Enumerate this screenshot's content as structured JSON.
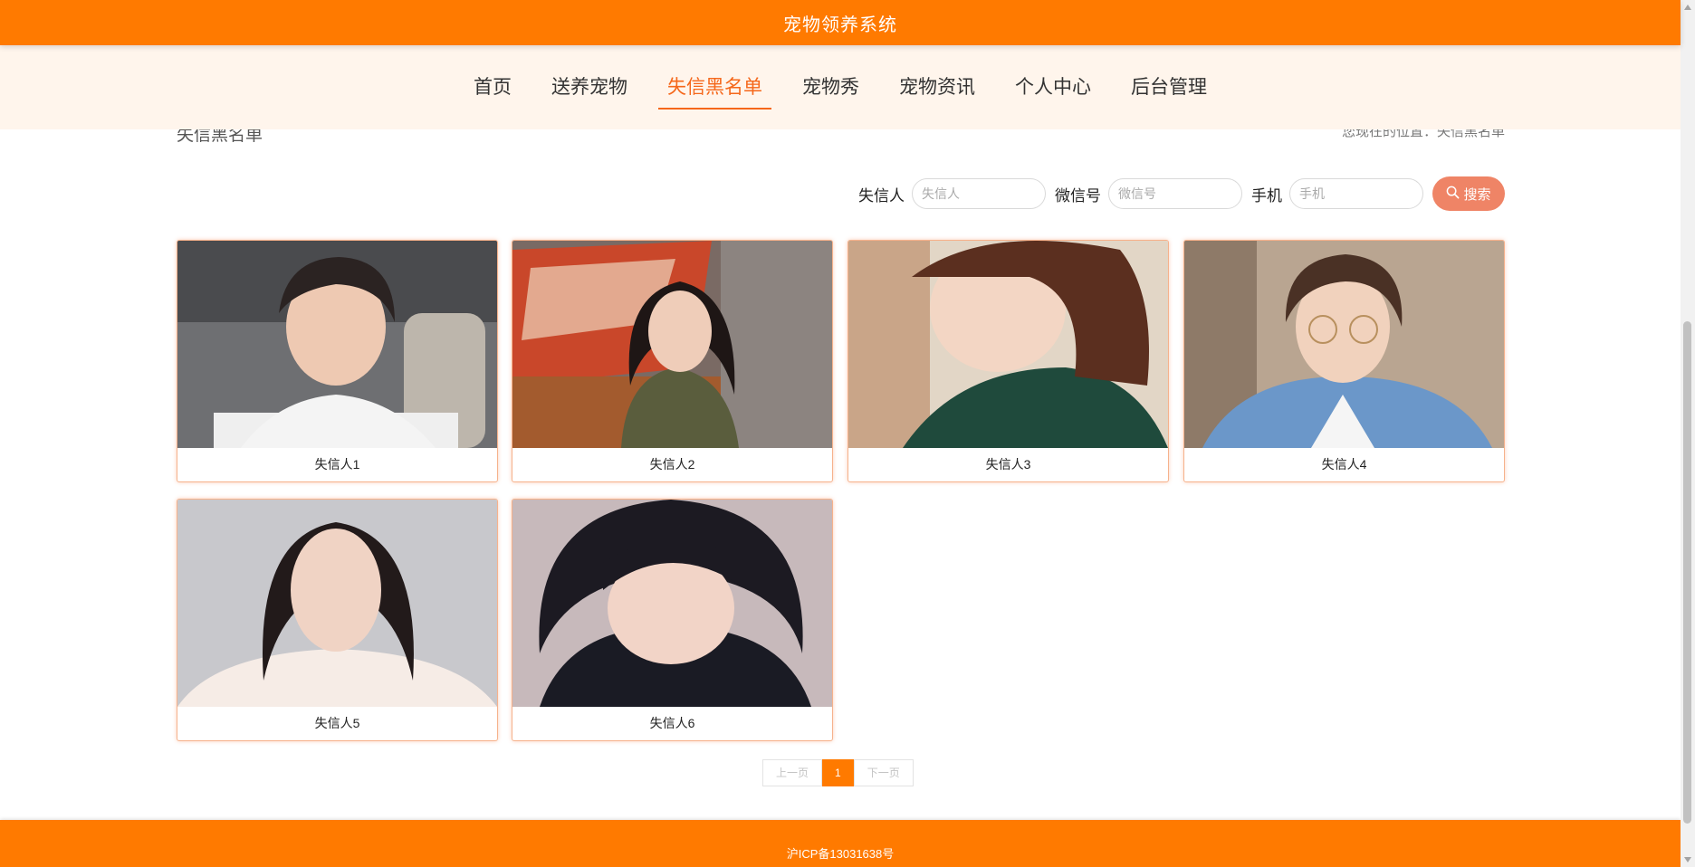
{
  "header": {
    "title": "宠物领养系统"
  },
  "nav": {
    "items": [
      {
        "label": "首页"
      },
      {
        "label": "送养宠物"
      },
      {
        "label": "失信黑名单"
      },
      {
        "label": "宠物秀"
      },
      {
        "label": "宠物资讯"
      },
      {
        "label": "个人中心"
      },
      {
        "label": "后台管理"
      }
    ],
    "active_index": 2
  },
  "breadcrumb": {
    "left": "失信黑名单",
    "right": "您现在的位置：失信黑名单"
  },
  "search": {
    "fields": [
      {
        "label": "失信人",
        "placeholder": "失信人",
        "value": ""
      },
      {
        "label": "微信号",
        "placeholder": "微信号",
        "value": ""
      },
      {
        "label": "手机",
        "placeholder": "手机",
        "value": ""
      }
    ],
    "button_label": "搜索",
    "button_icon": "search-icon"
  },
  "cards": [
    {
      "name": "失信人1"
    },
    {
      "name": "失信人2"
    },
    {
      "name": "失信人3"
    },
    {
      "name": "失信人4"
    },
    {
      "name": "失信人5"
    },
    {
      "name": "失信人6"
    }
  ],
  "pagination": {
    "prev": "上一页",
    "current": "1",
    "next": "下一页"
  },
  "footer": {
    "text": "沪ICP备13031638号"
  },
  "colors": {
    "primary": "#ff7a00",
    "nav_bg": "#fff5ec",
    "active": "#f5671a",
    "search_button": "#ef8466"
  }
}
